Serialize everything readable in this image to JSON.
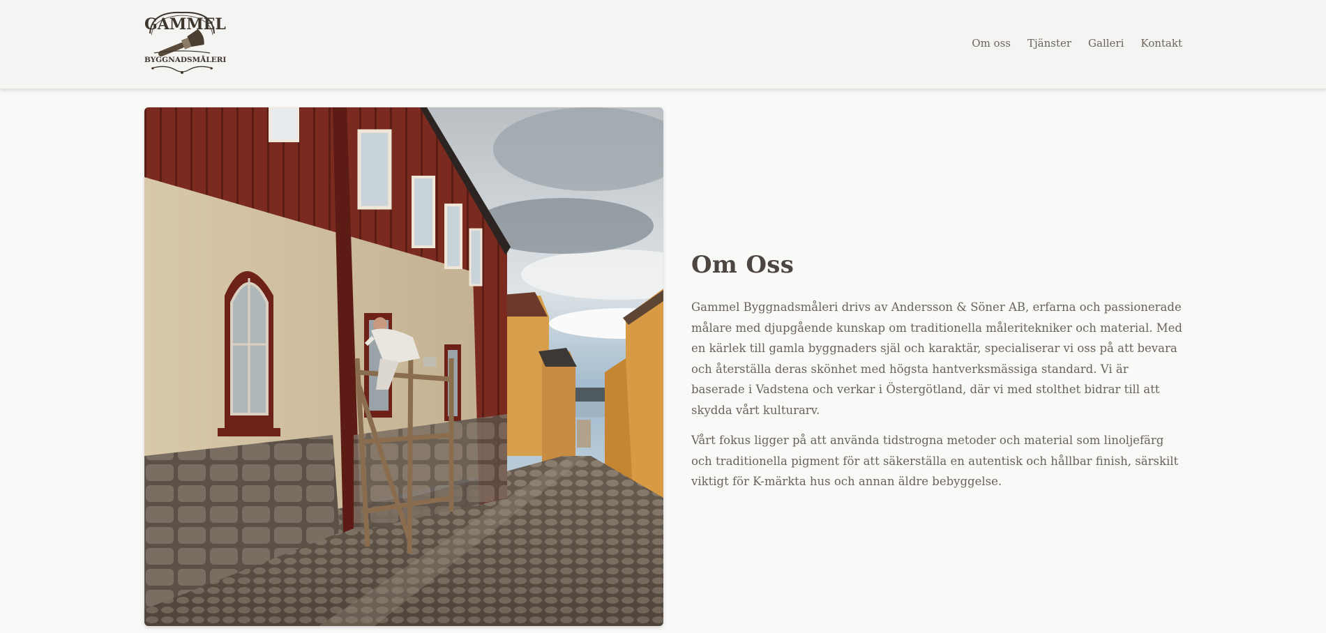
{
  "brand": {
    "logo_top": "GAMMEL",
    "logo_bottom": "BYGGNADSMÅLERI"
  },
  "nav": {
    "items": [
      {
        "label": "Om oss"
      },
      {
        "label": "Tjänster"
      },
      {
        "label": "Galleri"
      },
      {
        "label": "Kontakt"
      }
    ]
  },
  "about": {
    "heading": "Om Oss",
    "paragraphs": [
      "Gammel Byggnadsmåleri drivs av Andersson & Söner AB, erfarna och passionerade målare med djupgående kunskap om traditionella målerit­ekniker och material. Med en kärlek till gamla byggnaders själ och karaktär, specialiserar vi oss på att bevara och återställa deras skönhet med högsta hantverksmässiga standard. Vi är baserade i Vadstena och verkar i Östergötland, där vi med stolthet bidrar till att skydda vårt kulturarv.",
      "Vårt fokus ligger på att använda tidstrogna metoder och material som linoljefärg och traditionella pigment för att säkerställa en autentisk och hållbar finish, särskilt viktigt för K-märkta hus och annan äldre bebyggelse."
    ]
  },
  "colors": {
    "background": "#f9f9f7",
    "header": "#f4f4f2",
    "text": "#6a625b",
    "heading": "#4d4540"
  }
}
